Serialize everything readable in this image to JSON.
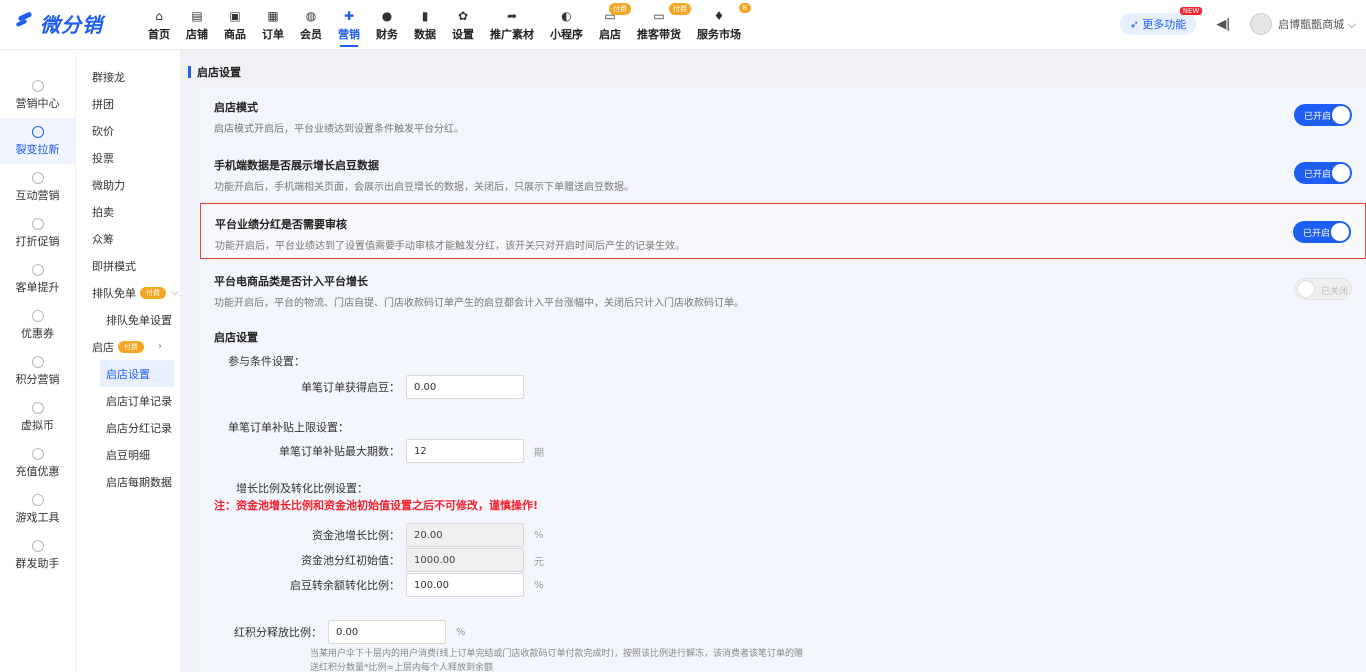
{
  "app": {
    "logo_text": "微分销"
  },
  "nav": [
    {
      "label": "首页",
      "icon": "home-icon"
    },
    {
      "label": "店铺",
      "icon": "store-icon"
    },
    {
      "label": "商品",
      "icon": "goods-icon"
    },
    {
      "label": "订单",
      "icon": "order-icon"
    },
    {
      "label": "会员",
      "icon": "member-icon"
    },
    {
      "label": "营销",
      "icon": "marketing-icon",
      "active": true
    },
    {
      "label": "财务",
      "icon": "finance-icon"
    },
    {
      "label": "数据",
      "icon": "data-icon"
    },
    {
      "label": "设置",
      "icon": "settings-icon"
    },
    {
      "label": "推广素材",
      "icon": "share-icon"
    },
    {
      "label": "小程序",
      "icon": "miniprogram-icon"
    },
    {
      "label": "启店",
      "icon": "open-store-icon",
      "badge": "付费"
    },
    {
      "label": "推客带货",
      "icon": "promoter-icon",
      "badge": "付费"
    },
    {
      "label": "服务市场",
      "icon": "market-icon",
      "badge": "8"
    }
  ],
  "topright": {
    "more_label": "更多功能",
    "new_badge": "NEW",
    "shop_name": "启博甑甑商城"
  },
  "left_nav": [
    {
      "label": "营销中心"
    },
    {
      "label": "裂变拉新",
      "active": true
    },
    {
      "label": "互动营销"
    },
    {
      "label": "打折促销"
    },
    {
      "label": "客单提升"
    },
    {
      "label": "优惠券"
    },
    {
      "label": "积分营销"
    },
    {
      "label": "虚拟币"
    },
    {
      "label": "充值优惠"
    },
    {
      "label": "游戏工具"
    },
    {
      "label": "群发助手"
    }
  ],
  "sub_nav": {
    "items": [
      "群接龙",
      "拼团",
      "砍价",
      "投票",
      "微助力",
      "拍卖",
      "众筹",
      "即拼模式"
    ],
    "queue_label": "排队免单",
    "queue_badge": "付费",
    "queue_setting": "排队免单设置",
    "store_label": "启店",
    "store_badge": "付费",
    "store_children": [
      "启店设置",
      "启店订单记录",
      "启店分红记录",
      "启豆明细",
      "启店每期数据"
    ]
  },
  "section_title": "启店设置",
  "settings": [
    {
      "title": "启店模式",
      "desc": "启店模式开启后，平台业绩达到设置条件触发平台分红。",
      "state": "已开启",
      "on": true
    },
    {
      "title": "手机端数据是否展示增长启豆数据",
      "desc": "功能开启后，手机端相关页面，会展示出启豆增长的数据，关闭后，只展示下单赠送启豆数据。",
      "state": "已开启",
      "on": true
    },
    {
      "title": "平台业绩分红是否需要审核",
      "desc": "功能开启后，平台业绩达到了设置值需要手动审核才能触发分红，该开关只对开启时间后产生的记录生效。",
      "state": "已开启",
      "on": true
    },
    {
      "title": "平台电商品类是否计入平台增长",
      "desc": "功能开启后，平台的物流、门店自提、门店收款码订单产生的启豆都会计入平台涨幅中，关闭后只计入门店收款码订单。",
      "state": "已关闭",
      "on": false
    }
  ],
  "form": {
    "card_title": "启店设置",
    "group1": "参与条件设置：",
    "beans_label": "单笔订单获得启豆：",
    "beans_value": "0.00",
    "group2": "单笔订单补贴上限设置：",
    "periods_label": "单笔订单补贴最大期数：",
    "periods_value": "12",
    "periods_unit": "期",
    "group3": "增长比例及转化比例设置：",
    "warning": "注：资金池增长比例和资金池初始值设置之后不可修改，谨慎操作!",
    "pool_growth_label": "资金池增长比例：",
    "pool_growth_value": "20.00",
    "pool_growth_unit": "%",
    "pool_init_label": "资金池分红初始值：",
    "pool_init_value": "1000.00",
    "pool_init_unit": "元",
    "beans_convert_label": "启豆转余额转化比例：",
    "beans_convert_value": "100.00",
    "beans_convert_unit": "%",
    "release_label": "红积分释放比例：",
    "release_value": "0.00",
    "release_unit": "%",
    "note": "当某用户伞下十层内的用户消费(线上订单完结或门店收款码订单付款完成时)，按照该比例进行解冻，该消费者该笔订单的赠送红积分数量*比例=上层内每个人释放到余额"
  }
}
